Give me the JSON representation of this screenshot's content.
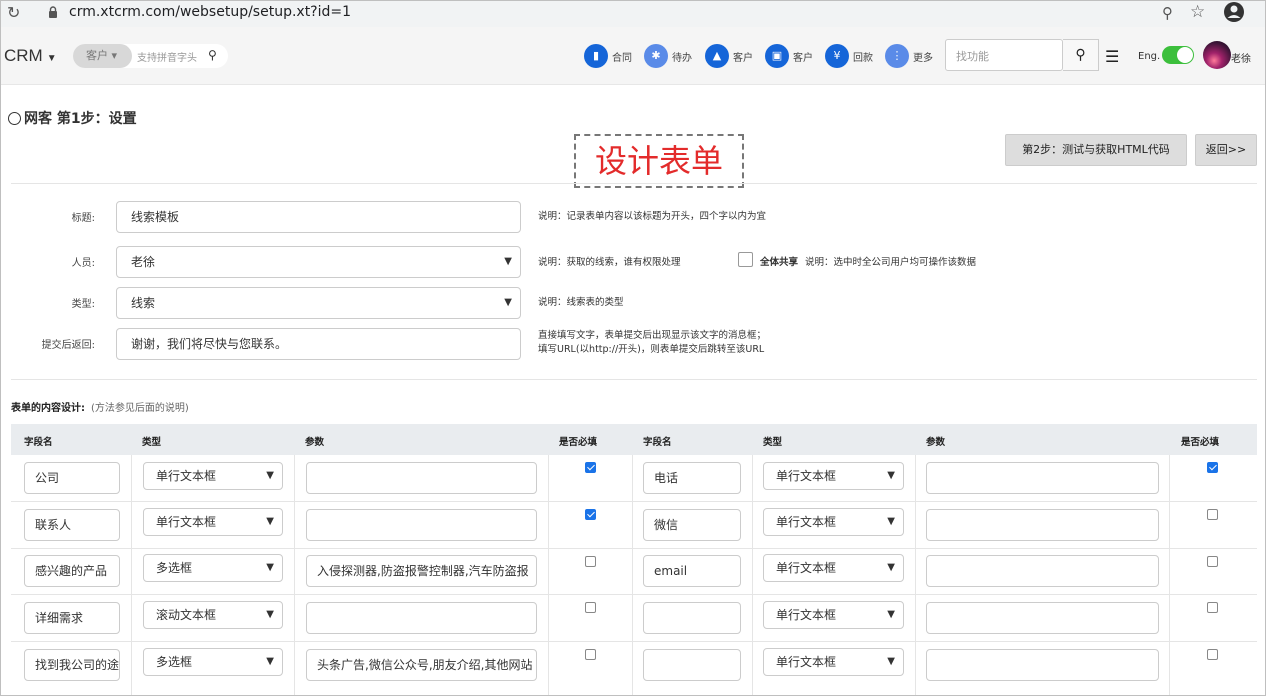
{
  "browser": {
    "url": "crm.xtcrm.com/websetup/setup.xt?id=1"
  },
  "navbar": {
    "brand": "CRM",
    "search_type": "客户 ▾",
    "search_hint": "支持拼音字头",
    "quick_links": [
      "合同",
      "待办",
      "客户",
      "客户",
      "回款",
      "更多"
    ],
    "function_search_placeholder": "找功能",
    "lang_label": "Eng.",
    "lang_enabled": true,
    "user_name": "老徐"
  },
  "page": {
    "title": "网客 第1步：设置",
    "design_label": "设计表单",
    "step2_button": "第2步：测试与获取HTML代码",
    "back_button": "返回>>"
  },
  "settings": {
    "title_label": "标题:",
    "title_value": "线索模板",
    "title_hint": "说明：记录表单内容以该标题为开头，四个字以内为宜",
    "owner_label": "人员:",
    "owner_value": "老徐",
    "owner_hint": "说明：获取的线索，谁有权限处理",
    "share_label": "全体共享",
    "share_hint": "说明：选中时全公司用户均可操作该数据",
    "share_checked": false,
    "type_label": "类型:",
    "type_value": "线索",
    "type_hint": "说明：线索表的类型",
    "return_label": "提交后返回:",
    "return_value": "谢谢，我们将尽快与您联系。",
    "return_hint_1": "直接填写文字，表单提交后出现显示该文字的消息框；",
    "return_hint_2": "填写URL(以http://开头)，则表单提交后跳转至该URL"
  },
  "content_design": {
    "title": "表单的内容设计:",
    "note": "(方法参见后面的说明)",
    "headers": {
      "field": "字段名",
      "type": "类型",
      "param": "参数",
      "required": "是否必填"
    },
    "rows": [
      {
        "left": {
          "field": "公司",
          "type": "单行文本框",
          "param": "",
          "required": true
        },
        "right": {
          "field": "电话",
          "type": "单行文本框",
          "param": "",
          "required": true
        }
      },
      {
        "left": {
          "field": "联系人",
          "type": "单行文本框",
          "param": "",
          "required": true
        },
        "right": {
          "field": "微信",
          "type": "单行文本框",
          "param": "",
          "required": false
        }
      },
      {
        "left": {
          "field": "感兴趣的产品",
          "type": "多选框",
          "param": "入侵探测器,防盗报警控制器,汽车防盗报",
          "required": false
        },
        "right": {
          "field": "email",
          "type": "单行文本框",
          "param": "",
          "required": false
        }
      },
      {
        "left": {
          "field": "详细需求",
          "type": "滚动文本框",
          "param": "",
          "required": false
        },
        "right": {
          "field": "",
          "type": "单行文本框",
          "param": "",
          "required": false
        }
      },
      {
        "left": {
          "field": "找到我公司的途",
          "type": "多选框",
          "param": "头条广告,微信公众号,朋友介绍,其他网站",
          "required": false
        },
        "right": {
          "field": "",
          "type": "单行文本框",
          "param": "",
          "required": false
        }
      }
    ]
  }
}
